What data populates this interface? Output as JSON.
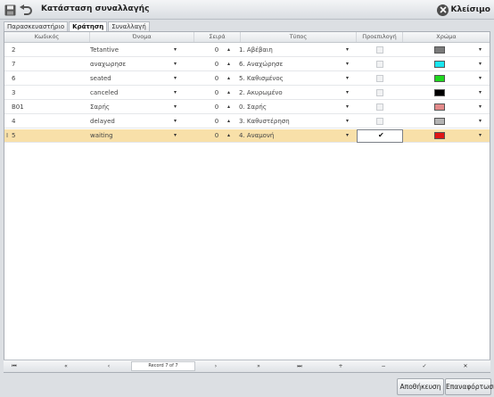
{
  "window": {
    "title": "Κατάσταση συναλλαγής",
    "close_label": "Κλείσιμο"
  },
  "icons": {
    "save": "save-icon",
    "undo": "undo-icon",
    "close": "close-icon"
  },
  "tabs": [
    {
      "label": "Παρασκευαστήριο",
      "active": false
    },
    {
      "label": "Κράτηση",
      "active": true
    },
    {
      "label": "Συναλλαγή",
      "active": false
    }
  ],
  "grid": {
    "columns": [
      "Κωδικός",
      "Όνομα",
      "Σειρά",
      "Τύπος",
      "Προεπιλογή",
      "Χρώμα"
    ],
    "rows": [
      {
        "code": "2",
        "name": "Tetantive",
        "order": "0",
        "type": "1. Αβέβαιη",
        "default": false,
        "color": "#7a7a7a"
      },
      {
        "code": "7",
        "name": "αναχωρησε",
        "order": "0",
        "type": "6. Αναχώρησε",
        "default": false,
        "color": "#19e6f0"
      },
      {
        "code": "6",
        "name": "seated",
        "order": "0",
        "type": "5. Καθισμένος",
        "default": false,
        "color": "#1fd81f"
      },
      {
        "code": "3",
        "name": "canceled",
        "order": "0",
        "type": "2. Ακυρωμένο",
        "default": false,
        "color": "#000000"
      },
      {
        "code": "B01",
        "name": "Σαρής",
        "order": "0",
        "type": "0. Σαρής",
        "default": false,
        "color": "#e38a8a"
      },
      {
        "code": "4",
        "name": "delayed",
        "order": "0",
        "type": "3. Καθυστέρηση",
        "default": false,
        "color": "#b3b3b3"
      },
      {
        "code": "5",
        "name": "waiting",
        "order": "0",
        "type": "4. Αναμονή",
        "default": true,
        "color": "#e01616",
        "selected": true
      }
    ]
  },
  "navigator": {
    "record_text": "Record 7 of 7",
    "buttons": [
      "⏮",
      "«",
      "‹",
      "›",
      "»",
      "⏭",
      "+",
      "−",
      "✓",
      "✕"
    ]
  },
  "footer": {
    "save_label": "Αποθήκευση",
    "reload_label": "Επαναφόρτωση"
  },
  "colors": {
    "selected_row": "#f8e0a9",
    "window_bg": "#dcdfe3"
  }
}
